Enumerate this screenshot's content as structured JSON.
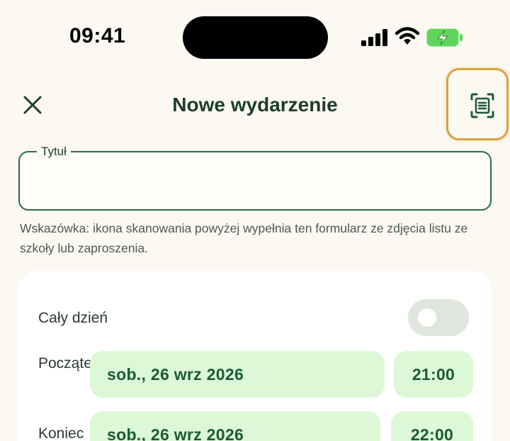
{
  "status_bar": {
    "time": "09:41"
  },
  "header": {
    "title": "Nowe wydarzenie"
  },
  "title_field": {
    "label": "Tytuł",
    "value": "",
    "hint": "Wskazówka: ikona skanowania powyżej wypełnia ten formularz ze zdjęcia listu ze szkoły lub zaproszenia."
  },
  "event_card": {
    "all_day_label": "Cały dzień",
    "all_day_on": false,
    "start": {
      "label": "Początek",
      "date": "sob., 26 wrz 2026",
      "time": "21:00"
    },
    "end": {
      "label": "Koniec",
      "date": "sob., 26 wrz 2026",
      "time": "22:00"
    }
  },
  "colors": {
    "accent": "#2d6a45",
    "highlight": "#d9a23f",
    "pill_bg": "#ddf8d7",
    "background": "#fbf9f1"
  },
  "icons": {
    "close": "close-icon",
    "scan": "document-scan-icon",
    "signal": "cellular-signal-icon",
    "wifi": "wifi-icon",
    "battery": "battery-charging-icon"
  }
}
